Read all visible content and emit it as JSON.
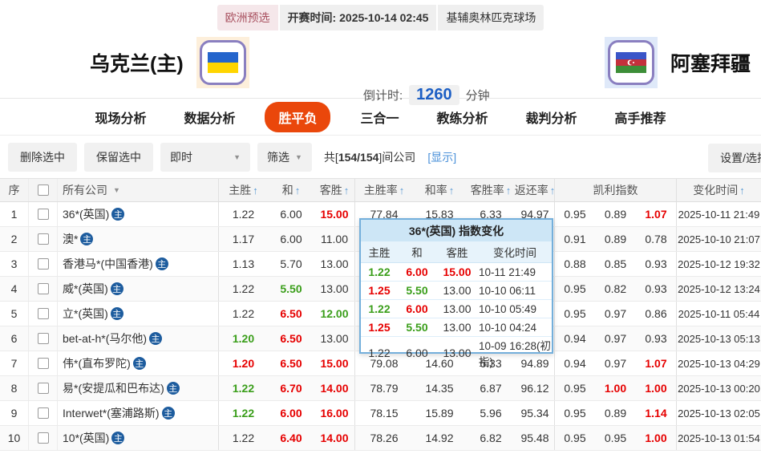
{
  "icons": {
    "sort_asc": "↑",
    "chevron_down": "▼"
  },
  "colors": {
    "accent_tab": "#ea470b",
    "odds_up": "#e60000",
    "odds_down": "#3a9e1a",
    "countdown_blue": "#1b5ec4",
    "badge_blue": "#1d5c9e",
    "popup_border": "#74afdb"
  },
  "match_bar": {
    "league": "欧洲预选",
    "kickoff_label": "开赛时间:",
    "kickoff_time": "2025-10-14 02:45",
    "venue": "基辅奥林匹克球场"
  },
  "teams": {
    "home": {
      "name": "乌克兰(主)",
      "flag": "ukraine-flag"
    },
    "away": {
      "name": "阿塞拜疆",
      "flag": "azerbaijan-flag"
    },
    "countdown": {
      "label": "倒计时:",
      "value": "1260",
      "unit": "分钟"
    }
  },
  "tabs": [
    {
      "label": "现场分析",
      "active": false
    },
    {
      "label": "数据分析",
      "active": false
    },
    {
      "label": "胜平负",
      "active": true
    },
    {
      "label": "三合一",
      "active": false
    },
    {
      "label": "教练分析",
      "active": false
    },
    {
      "label": "裁判分析",
      "active": false
    },
    {
      "label": "高手推荐",
      "active": false
    }
  ],
  "toolbar": {
    "delete_selected": "删除选中",
    "keep_selected": "保留选中",
    "time_filter": "即时",
    "filter": "筛选",
    "count_prefix": "共[",
    "count_value": "154/154",
    "count_suffix": "]间公司",
    "show_link": "[显示]",
    "settings": "设置/选择"
  },
  "table": {
    "headers": {
      "seq": "序",
      "company": "所有公司",
      "home": "主胜",
      "draw": "和",
      "away": "客胜",
      "home_rate": "主胜率",
      "draw_rate": "和率",
      "away_rate": "客胜率",
      "payout": "返还率",
      "kelly": "凯利指数",
      "change_time": "变化时间"
    },
    "rows": [
      {
        "no": "1",
        "company": "36*(英国)",
        "odds": [
          {
            "v": "1.22",
            "c": "k"
          },
          {
            "v": "6.00",
            "c": "k"
          },
          {
            "v": "15.00",
            "c": "r"
          }
        ],
        "rates": [
          "77.84",
          "15.83",
          "6.33",
          "94.97"
        ],
        "kelly": [
          {
            "v": "0.95",
            "c": "k"
          },
          {
            "v": "0.89",
            "c": "k"
          },
          {
            "v": "1.07",
            "c": "r"
          }
        ],
        "time": "2025-10-11 21:49"
      },
      {
        "no": "2",
        "company": "澳*",
        "odds": [
          {
            "v": "1.17",
            "c": "k"
          },
          {
            "v": "6.00",
            "c": "k"
          },
          {
            "v": "11.00",
            "c": "k"
          }
        ],
        "rates": [
          "",
          "",
          "",
          ""
        ],
        "kelly": [
          {
            "v": "0.91",
            "c": "k"
          },
          {
            "v": "0.89",
            "c": "k"
          },
          {
            "v": "0.78",
            "c": "k"
          }
        ],
        "time": "2025-10-10 21:07"
      },
      {
        "no": "3",
        "company": "香港马*(中国香港)",
        "odds": [
          {
            "v": "1.13",
            "c": "k"
          },
          {
            "v": "5.70",
            "c": "k"
          },
          {
            "v": "13.00",
            "c": "k"
          }
        ],
        "rates": [
          "",
          "",
          "",
          ""
        ],
        "kelly": [
          {
            "v": "0.88",
            "c": "k"
          },
          {
            "v": "0.85",
            "c": "k"
          },
          {
            "v": "0.93",
            "c": "k"
          }
        ],
        "time": "2025-10-12 19:32"
      },
      {
        "no": "4",
        "company": "威*(英国)",
        "odds": [
          {
            "v": "1.22",
            "c": "k"
          },
          {
            "v": "5.50",
            "c": "g"
          },
          {
            "v": "13.00",
            "c": "k"
          }
        ],
        "rates": [
          "",
          "",
          "",
          ""
        ],
        "kelly": [
          {
            "v": "0.95",
            "c": "k"
          },
          {
            "v": "0.82",
            "c": "k"
          },
          {
            "v": "0.93",
            "c": "k"
          }
        ],
        "time": "2025-10-12 13:24"
      },
      {
        "no": "5",
        "company": "立*(英国)",
        "odds": [
          {
            "v": "1.22",
            "c": "k"
          },
          {
            "v": "6.50",
            "c": "r"
          },
          {
            "v": "12.00",
            "c": "g"
          }
        ],
        "rates": [
          "",
          "",
          "",
          ""
        ],
        "kelly": [
          {
            "v": "0.95",
            "c": "k"
          },
          {
            "v": "0.97",
            "c": "k"
          },
          {
            "v": "0.86",
            "c": "k"
          }
        ],
        "time": "2025-10-11 05:44"
      },
      {
        "no": "6",
        "company": "bet-at-h*(马尔他)",
        "odds": [
          {
            "v": "1.20",
            "c": "g"
          },
          {
            "v": "6.50",
            "c": "r"
          },
          {
            "v": "13.00",
            "c": "k"
          }
        ],
        "rates": [
          "",
          "",
          "",
          ""
        ],
        "kelly": [
          {
            "v": "0.94",
            "c": "k"
          },
          {
            "v": "0.97",
            "c": "k"
          },
          {
            "v": "0.93",
            "c": "k"
          }
        ],
        "time": "2025-10-13 05:13"
      },
      {
        "no": "7",
        "company": "伟*(直布罗陀)",
        "odds": [
          {
            "v": "1.20",
            "c": "r"
          },
          {
            "v": "6.50",
            "c": "r"
          },
          {
            "v": "15.00",
            "c": "r"
          }
        ],
        "rates": [
          "79.08",
          "14.60",
          "6.33",
          "94.89"
        ],
        "kelly": [
          {
            "v": "0.94",
            "c": "k"
          },
          {
            "v": "0.97",
            "c": "k"
          },
          {
            "v": "1.07",
            "c": "r"
          }
        ],
        "time": "2025-10-13 04:29"
      },
      {
        "no": "8",
        "company": "易*(安提瓜和巴布达)",
        "odds": [
          {
            "v": "1.22",
            "c": "g"
          },
          {
            "v": "6.70",
            "c": "r"
          },
          {
            "v": "14.00",
            "c": "r"
          }
        ],
        "rates": [
          "78.79",
          "14.35",
          "6.87",
          "96.12"
        ],
        "kelly": [
          {
            "v": "0.95",
            "c": "k"
          },
          {
            "v": "1.00",
            "c": "r"
          },
          {
            "v": "1.00",
            "c": "r"
          }
        ],
        "time": "2025-10-13 00:20"
      },
      {
        "no": "9",
        "company": "Interwet*(塞浦路斯)",
        "odds": [
          {
            "v": "1.22",
            "c": "g"
          },
          {
            "v": "6.00",
            "c": "r"
          },
          {
            "v": "16.00",
            "c": "r"
          }
        ],
        "rates": [
          "78.15",
          "15.89",
          "5.96",
          "95.34"
        ],
        "kelly": [
          {
            "v": "0.95",
            "c": "k"
          },
          {
            "v": "0.89",
            "c": "k"
          },
          {
            "v": "1.14",
            "c": "r"
          }
        ],
        "time": "2025-10-13 02:05"
      },
      {
        "no": "10",
        "company": "10*(英国)",
        "odds": [
          {
            "v": "1.22",
            "c": "k"
          },
          {
            "v": "6.40",
            "c": "r"
          },
          {
            "v": "14.00",
            "c": "r"
          }
        ],
        "rates": [
          "78.26",
          "14.92",
          "6.82",
          "95.48"
        ],
        "kelly": [
          {
            "v": "0.95",
            "c": "k"
          },
          {
            "v": "0.95",
            "c": "k"
          },
          {
            "v": "1.00",
            "c": "r"
          }
        ],
        "time": "2025-10-13 01:54"
      }
    ],
    "badge_label": "主"
  },
  "popup": {
    "title": "36*(英国) 指数变化",
    "headers": [
      "主胜",
      "和",
      "客胜",
      "变化时间"
    ],
    "rows": [
      {
        "home": {
          "v": "1.22",
          "c": "g"
        },
        "draw": {
          "v": "6.00",
          "c": "r"
        },
        "away": {
          "v": "15.00",
          "c": "r"
        },
        "time": "10-11 21:49"
      },
      {
        "home": {
          "v": "1.25",
          "c": "r"
        },
        "draw": {
          "v": "5.50",
          "c": "g"
        },
        "away": {
          "v": "13.00",
          "c": "k"
        },
        "time": "10-10 06:11"
      },
      {
        "home": {
          "v": "1.22",
          "c": "g"
        },
        "draw": {
          "v": "6.00",
          "c": "r"
        },
        "away": {
          "v": "13.00",
          "c": "k"
        },
        "time": "10-10 05:49"
      },
      {
        "home": {
          "v": "1.25",
          "c": "r"
        },
        "draw": {
          "v": "5.50",
          "c": "g"
        },
        "away": {
          "v": "13.00",
          "c": "k"
        },
        "time": "10-10 04:24"
      },
      {
        "home": {
          "v": "1.22",
          "c": "k"
        },
        "draw": {
          "v": "6.00",
          "c": "k"
        },
        "away": {
          "v": "13.00",
          "c": "k"
        },
        "time": "10-09 16:28(初指)"
      }
    ]
  }
}
